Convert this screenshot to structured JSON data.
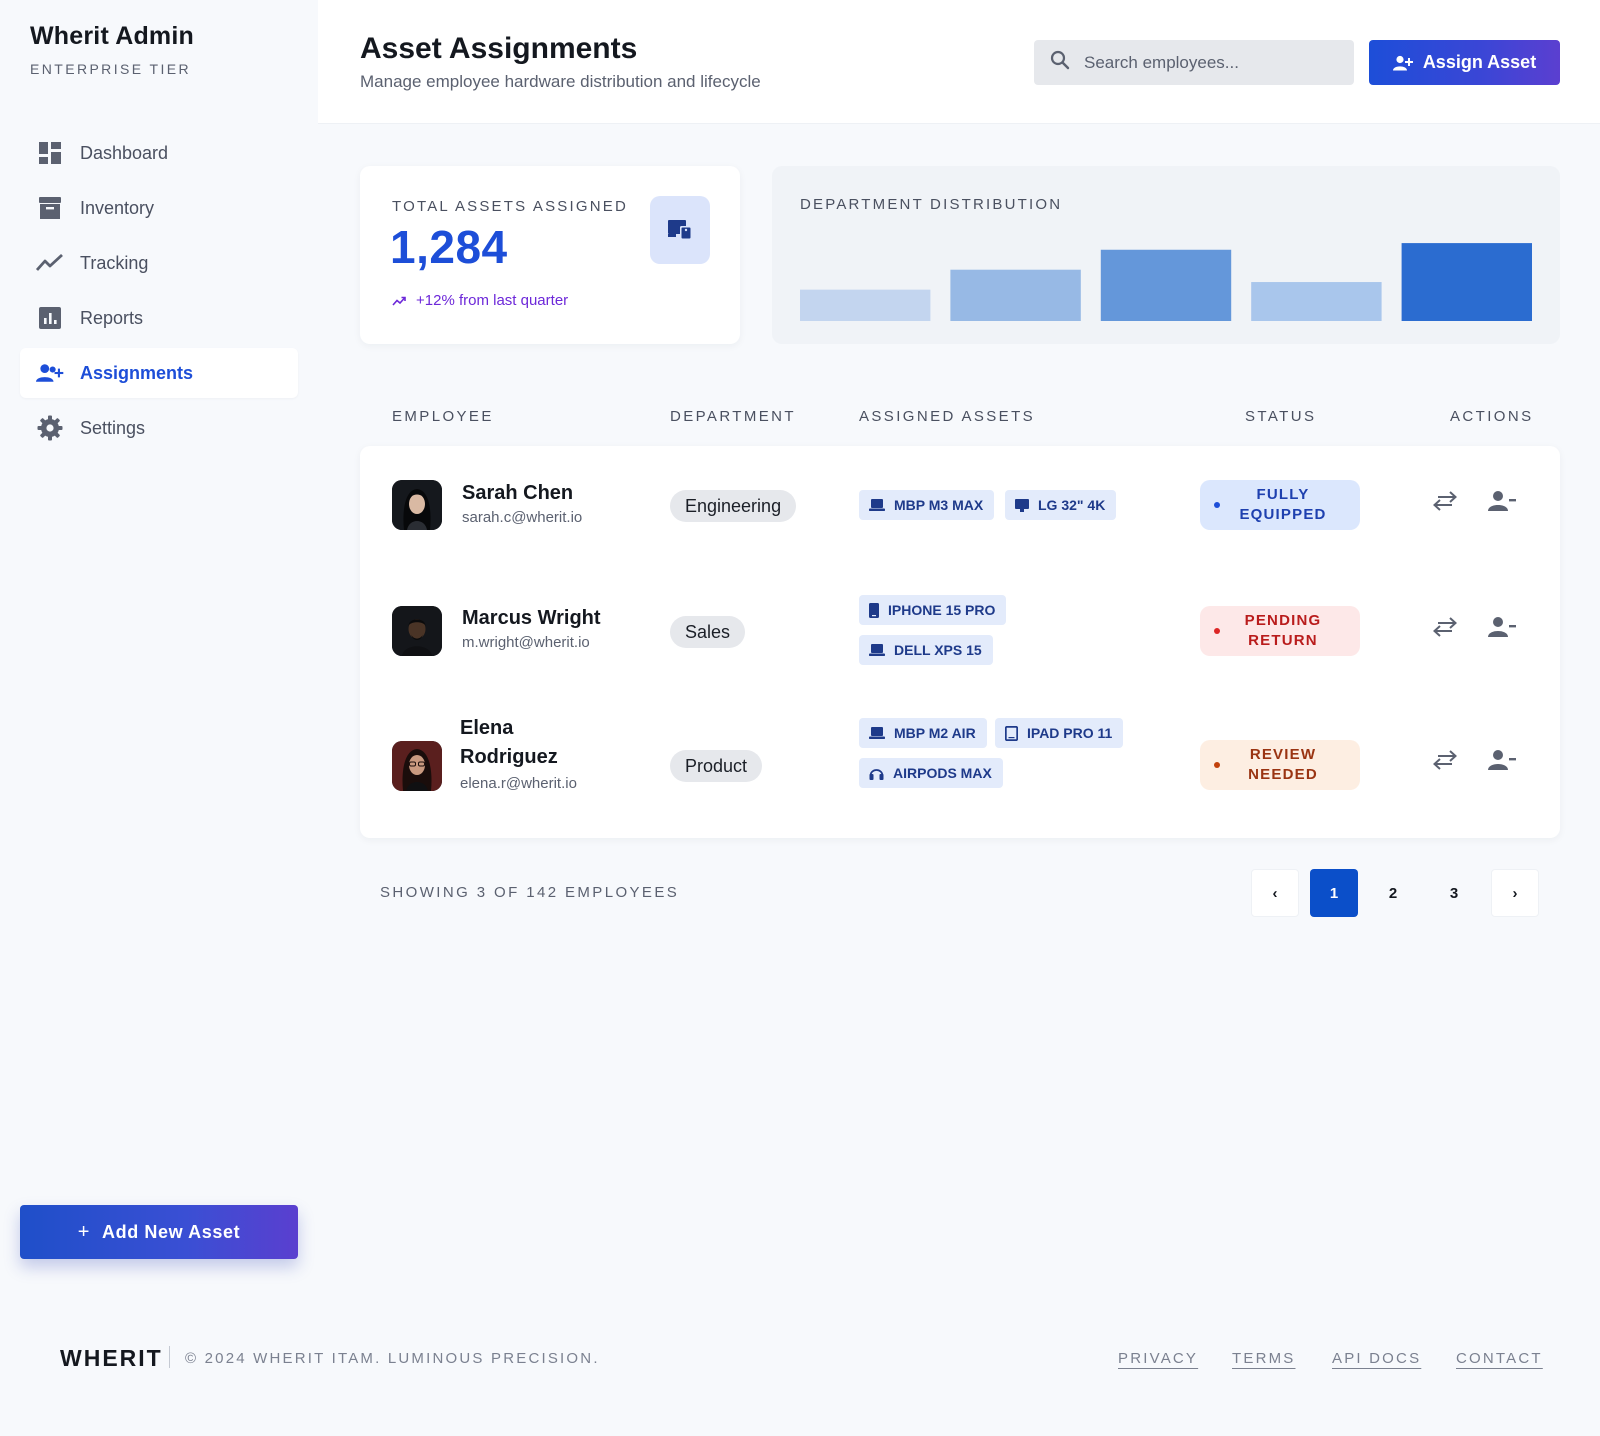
{
  "brand": {
    "title": "Wherit Admin",
    "subtitle": "ENTERPRISE TIER"
  },
  "sidebar": {
    "items": [
      {
        "label": "Dashboard",
        "icon": "dashboard-icon"
      },
      {
        "label": "Inventory",
        "icon": "archive-icon"
      },
      {
        "label": "Tracking",
        "icon": "trend-line-icon"
      },
      {
        "label": "Reports",
        "icon": "bar-report-icon"
      },
      {
        "label": "Assignments",
        "icon": "person-add-icon",
        "active": true
      },
      {
        "label": "Settings",
        "icon": "gear-icon"
      }
    ],
    "add_button": {
      "plus": "+",
      "label": "Add New Asset"
    }
  },
  "header": {
    "title": "Asset Assignments",
    "subtitle": "Manage employee hardware distribution and lifecycle",
    "search_placeholder": "Search employees...",
    "assign_label": "Assign Asset"
  },
  "stats": {
    "total_label": "TOTAL ASSETS ASSIGNED",
    "total_value": "1,284",
    "change": "+12% from last quarter",
    "icon": "devices-icon"
  },
  "distribution": {
    "label": "DEPARTMENT DISTRIBUTION",
    "chart_data": {
      "type": "bar",
      "title": "DEPARTMENT DISTRIBUTION",
      "categories": [
        "",
        "",
        "",
        "",
        ""
      ],
      "values": [
        33,
        54,
        75,
        41,
        82
      ],
      "ylim": [
        0,
        100
      ],
      "colors": [
        "#c3d5ef",
        "#97b9e5",
        "#6497da",
        "#a9c6ec",
        "#2b6cd0"
      ],
      "grid": false
    }
  },
  "table": {
    "headers": {
      "employee": "EMPLOYEE",
      "department": "DEPARTMENT",
      "assets": "ASSIGNED ASSETS",
      "status": "STATUS",
      "actions": "ACTIONS"
    },
    "rows": [
      {
        "name": "Sarah Chen",
        "email": "sarah.c@wherit.io",
        "department": "Engineering",
        "assets": [
          {
            "label": "MBP M3 MAX",
            "icon": "laptop-icon"
          },
          {
            "label": "LG 32\" 4K",
            "icon": "monitor-icon"
          }
        ],
        "status_l1": "FULLY",
        "status_l2": "EQUIPPED",
        "status_color": "blue"
      },
      {
        "name": "Marcus Wright",
        "email": "m.wright@wherit.io",
        "department": "Sales",
        "assets": [
          {
            "label": "IPHONE 15 PRO",
            "icon": "phone-icon"
          },
          {
            "label": "DELL XPS 15",
            "icon": "laptop-icon"
          }
        ],
        "status_l1": "PENDING",
        "status_l2": "RETURN",
        "status_color": "red"
      },
      {
        "name_l1": "Elena",
        "name_l2": "Rodriguez",
        "email": "elena.r@wherit.io",
        "department": "Product",
        "assets": [
          {
            "label": "MBP M2 AIR",
            "icon": "laptop-icon"
          },
          {
            "label": "IPAD PRO 11",
            "icon": "tablet-icon"
          },
          {
            "label": "AIRPODS MAX",
            "icon": "headphones-icon"
          }
        ],
        "status_l1": "REVIEW",
        "status_l2": "NEEDED",
        "status_color": "orange"
      }
    ]
  },
  "pagination": {
    "showing": "SHOWING 3 OF 142 EMPLOYEES",
    "prev": "‹",
    "next": "›",
    "pages": [
      "1",
      "2",
      "3"
    ],
    "current": "1"
  },
  "footer": {
    "logo": "WHERIT",
    "copyright": "© 2024 WHERIT ITAM. LUMINOUS PRECISION.",
    "links": [
      "PRIVACY",
      "TERMS",
      "API DOCS",
      "CONTACT"
    ]
  }
}
